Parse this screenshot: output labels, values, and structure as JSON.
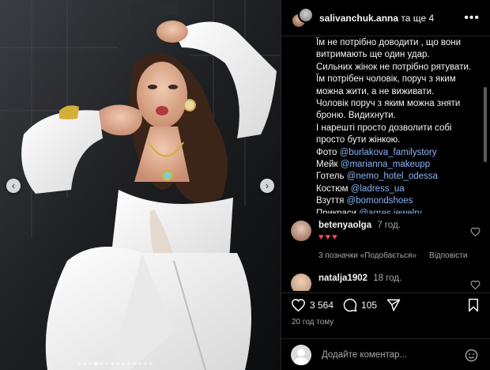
{
  "header": {
    "username": "salivanchuk.anna",
    "and_others": "та ще 4"
  },
  "caption": {
    "lines": [
      "Їм не потрібно доводити , що вони",
      "витримають ще один удар.",
      "Сильних жінок не потрібно рятувати.",
      "Їм потрібен чоловік, поруч з яким",
      "можна жити, а не виживати.",
      "Чоловік поруч з яким можна зняти",
      "броню. Видихнути.",
      "І нарешті просто дозволити собі",
      "просто бути жінкою."
    ],
    "credits": [
      {
        "label": "Фото",
        "handle": "@burlakova_familystory"
      },
      {
        "label": "Мейк",
        "handle": "@marianna_makeupp"
      },
      {
        "label": "Готель",
        "handle": "@nemo_hotel_odessa"
      },
      {
        "label": "Костюм",
        "handle": "@ladress_ua"
      },
      {
        "label": "Взуття",
        "handle": "@bomondshoes"
      },
      {
        "label": "Прикраси",
        "handle": "@agres.jewelry"
      }
    ]
  },
  "comments": [
    {
      "user": "betenyaolga",
      "time": "7 год.",
      "text": "♥♥♥",
      "likes": "3 позначки «Подобається»",
      "reply": "Відповісти"
    },
    {
      "user": "natalja1902",
      "time": "18 год."
    }
  ],
  "actions": {
    "likes": "3 564",
    "comments": "105"
  },
  "time_ago": "20 год тому",
  "add_comment": {
    "placeholder": "Додайте коментар..."
  },
  "colors": {
    "link": "#8ab4f8",
    "heart": "#ed4956",
    "border": "#262626",
    "muted": "#a8a8a8"
  },
  "carousel": {
    "total_slides": 14,
    "active_index": 3
  }
}
